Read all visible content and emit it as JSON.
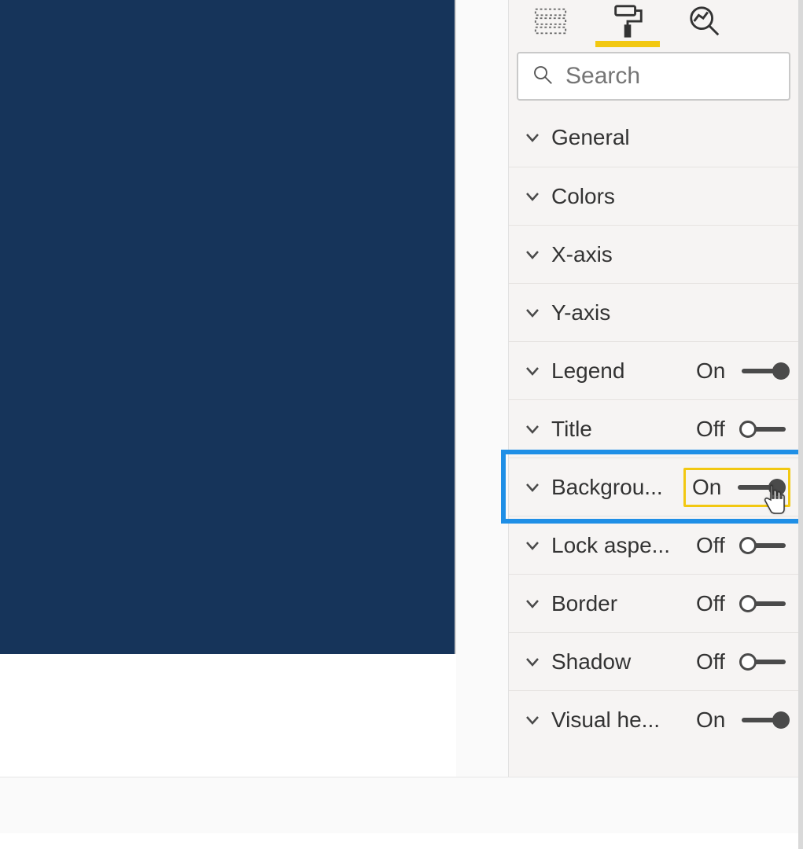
{
  "search": {
    "placeholder": "Search",
    "value": ""
  },
  "tabs": {
    "fields_active": false,
    "format_active": true,
    "analytics_active": false
  },
  "sections": [
    {
      "key": "general",
      "label": "General",
      "toggle": null
    },
    {
      "key": "colors",
      "label": "Colors",
      "toggle": null
    },
    {
      "key": "xaxis",
      "label": "X-axis",
      "toggle": null
    },
    {
      "key": "yaxis",
      "label": "Y-axis",
      "toggle": null
    },
    {
      "key": "legend",
      "label": "Legend",
      "toggle": {
        "state": "On",
        "on": true
      }
    },
    {
      "key": "title",
      "label": "Title",
      "toggle": {
        "state": "Off",
        "on": false
      }
    },
    {
      "key": "background",
      "label": "Backgrou...",
      "toggle": {
        "state": "On",
        "on": true
      },
      "highlighted": true,
      "selected": true
    },
    {
      "key": "lockaspect",
      "label": "Lock aspe...",
      "toggle": {
        "state": "Off",
        "on": false
      }
    },
    {
      "key": "border",
      "label": "Border",
      "toggle": {
        "state": "Off",
        "on": false
      }
    },
    {
      "key": "shadow",
      "label": "Shadow",
      "toggle": {
        "state": "Off",
        "on": false
      }
    },
    {
      "key": "visualhdr",
      "label": "Visual he...",
      "toggle": {
        "state": "On",
        "on": true
      }
    }
  ],
  "annotation": {
    "selected_section_key": "background",
    "cursor_on_toggle": true
  }
}
